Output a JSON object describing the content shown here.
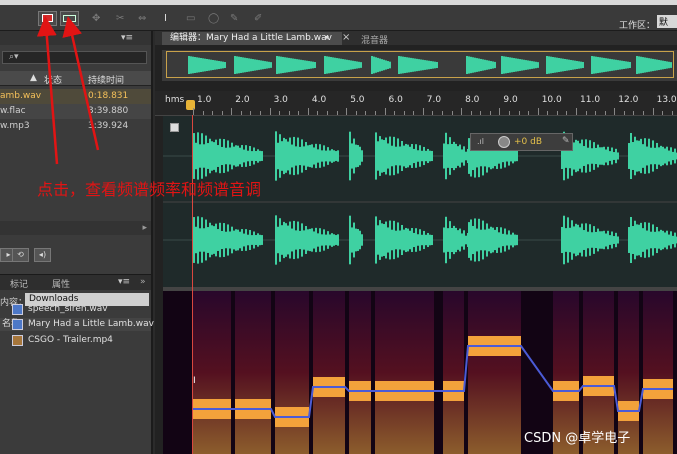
{
  "toolbar": {
    "spectral_freq_icon": "spectral-frequency-icon",
    "spectral_pitch_icon": "spectral-pitch-icon",
    "workspace_label": "工作区：",
    "workspace_value": "默"
  },
  "files_panel": {
    "menu_glyph": "▾≡",
    "close_glyph": "»",
    "search_glyph": "⌕▾",
    "col_state": "状态",
    "col_duration": "持续时间",
    "files": [
      {
        "name": "amb.wav",
        "duration": "0:18.831"
      },
      {
        "name": "w.flac",
        "duration": "3:39.880"
      },
      {
        "name": "w.mp3",
        "duration": "3:39.924"
      }
    ]
  },
  "media_panel": {
    "tab_markers": "标记",
    "tab_properties": "属性",
    "menu_glyph": "▾≡",
    "close_glyph": "»",
    "content_label": "内容：",
    "content_value": "Downloads",
    "name_header": "名称",
    "items": [
      {
        "name": "speech_siren.wav",
        "icon": "audio-file-icon"
      },
      {
        "name": "Mary Had a Little Lamb.wav",
        "icon": "audio-file-icon"
      },
      {
        "name": "CSGO - Trailer.mp4",
        "icon": "video-file-icon"
      }
    ]
  },
  "editor": {
    "tab_title": "编辑器：Mary Had a Little Lamb.wav",
    "tab_menu_glyph": "▾",
    "tab_close_glyph": "×",
    "mixer_tab": "混音器",
    "ruler_unit": "hms",
    "ticks": [
      "1.0",
      "2.0",
      "3.0",
      "4.0",
      "5.0",
      "6.0",
      "7.0",
      "8.0",
      "9.0",
      "10.0",
      "11.0",
      "12.0",
      "13.0"
    ],
    "hud_value": "+0 dB",
    "hud_pin_glyph": "✎",
    "cursor_label": "I"
  },
  "annotation": {
    "text": "点击，查看频谱频率和频谱音调",
    "color": "#e11414"
  },
  "watermark": "CSDN @卓学电子",
  "colors": {
    "waveform": "#3fd1a2",
    "playhead": "#e8b437",
    "pitch_line": "#4b5bd6"
  }
}
